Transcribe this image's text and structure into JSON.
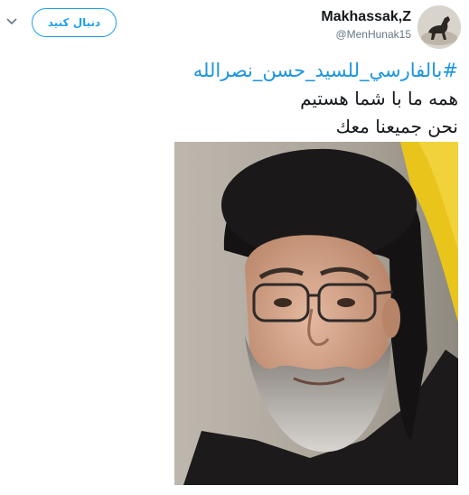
{
  "user": {
    "display_name": "Makhassak,Z",
    "handle": "@MenHunak15"
  },
  "actions": {
    "follow_label": "دنبال کنید",
    "more_icon": "chevron-down-icon"
  },
  "tweet": {
    "hashtag": "#بالفارسي_للسيد_حسن_نصرالله",
    "line_fa": "همه ما با شما هستیم",
    "line_ar": "نحن جميعنا معك"
  },
  "colors": {
    "link": "#1b95e0",
    "button_border": "#1da1f2",
    "text": "#14171a",
    "muted": "#657786"
  }
}
